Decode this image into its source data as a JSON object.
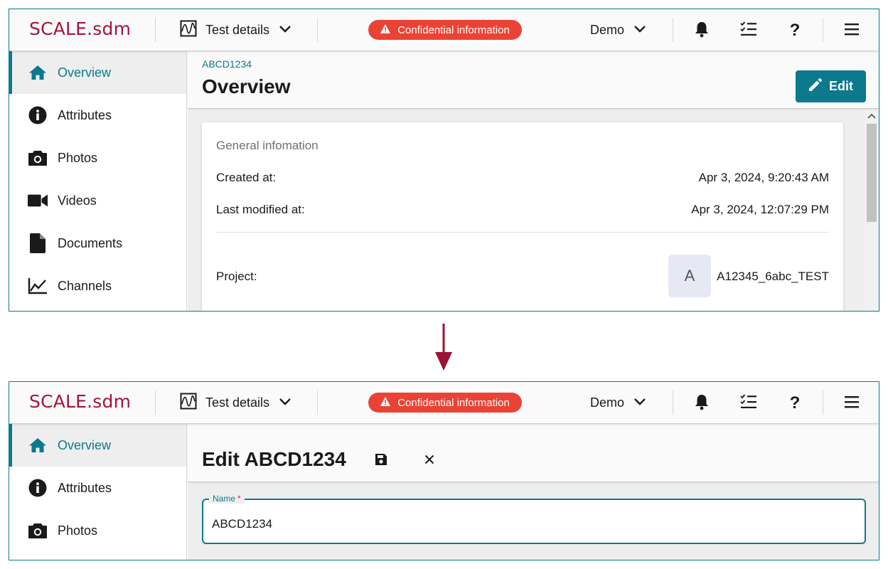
{
  "app": {
    "logo": "SCALE.sdm",
    "context": {
      "label": "Test details"
    },
    "confidential": "Confidential information",
    "user_menu": "Demo",
    "help": "?"
  },
  "sidebar": {
    "items": [
      {
        "label": "Overview",
        "icon": "home-icon",
        "active": true
      },
      {
        "label": "Attributes",
        "icon": "info-icon"
      },
      {
        "label": "Photos",
        "icon": "camera-icon"
      },
      {
        "label": "Videos",
        "icon": "video-camera-icon"
      },
      {
        "label": "Documents",
        "icon": "document-icon"
      },
      {
        "label": "Channels",
        "icon": "line-chart-icon"
      }
    ]
  },
  "view1": {
    "breadcrumb": "ABCD1234",
    "title": "Overview",
    "edit_button": "Edit",
    "card": {
      "title": "General infomation",
      "rows": [
        {
          "label": "Created at:",
          "value": "Apr 3, 2024, 9:20:43 AM"
        },
        {
          "label": "Last modified at:",
          "value": "Apr 3, 2024, 12:07:29 PM"
        }
      ],
      "project": {
        "label": "Project:",
        "avatar": "A",
        "value": "A12345_6abc_TEST"
      }
    }
  },
  "view2": {
    "title": "Edit ABCD1234",
    "name_field": {
      "label": "Name",
      "required_mark": "*",
      "value": "ABCD1234"
    }
  },
  "colors": {
    "accent": "#0a7a8c",
    "brand": "#a3153a",
    "alert": "#ea4335",
    "arrow": "#9b1336"
  }
}
